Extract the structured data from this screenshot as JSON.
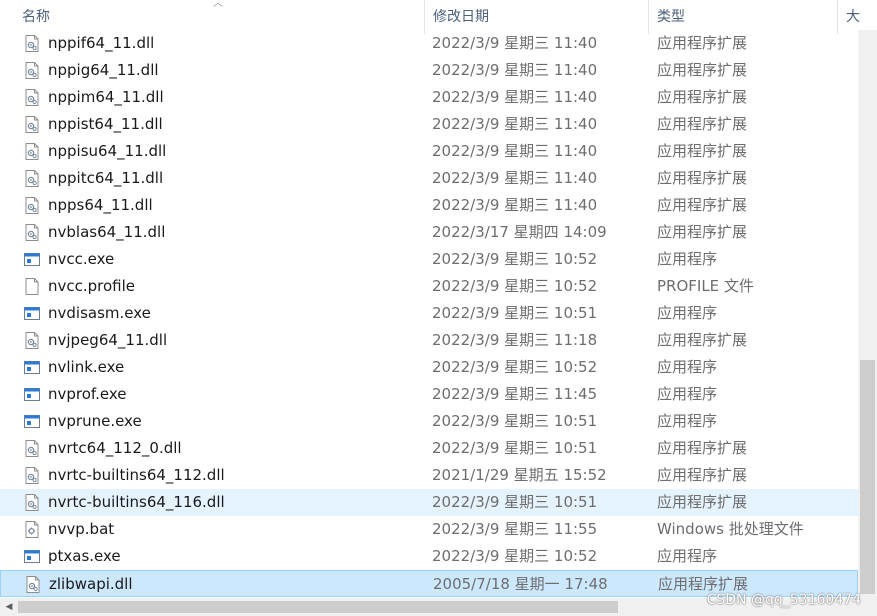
{
  "columns": {
    "name": "名称",
    "date": "修改日期",
    "type": "类型",
    "size": "大"
  },
  "files": [
    {
      "name": "nppif64_11.dll",
      "date": "2022/3/9 星期三 11:40",
      "type": "应用程序扩展",
      "icon": "dll-icon"
    },
    {
      "name": "nppig64_11.dll",
      "date": "2022/3/9 星期三 11:40",
      "type": "应用程序扩展",
      "icon": "dll-icon"
    },
    {
      "name": "nppim64_11.dll",
      "date": "2022/3/9 星期三 11:40",
      "type": "应用程序扩展",
      "icon": "dll-icon"
    },
    {
      "name": "nppist64_11.dll",
      "date": "2022/3/9 星期三 11:40",
      "type": "应用程序扩展",
      "icon": "dll-icon"
    },
    {
      "name": "nppisu64_11.dll",
      "date": "2022/3/9 星期三 11:40",
      "type": "应用程序扩展",
      "icon": "dll-icon"
    },
    {
      "name": "nppitc64_11.dll",
      "date": "2022/3/9 星期三 11:40",
      "type": "应用程序扩展",
      "icon": "dll-icon"
    },
    {
      "name": "npps64_11.dll",
      "date": "2022/3/9 星期三 11:40",
      "type": "应用程序扩展",
      "icon": "dll-icon"
    },
    {
      "name": "nvblas64_11.dll",
      "date": "2022/3/17 星期四 14:09",
      "type": "应用程序扩展",
      "icon": "dll-icon"
    },
    {
      "name": "nvcc.exe",
      "date": "2022/3/9 星期三 10:52",
      "type": "应用程序",
      "icon": "exe-icon"
    },
    {
      "name": "nvcc.profile",
      "date": "2022/3/9 星期三 10:52",
      "type": "PROFILE 文件",
      "icon": "file-icon"
    },
    {
      "name": "nvdisasm.exe",
      "date": "2022/3/9 星期三 10:51",
      "type": "应用程序",
      "icon": "exe-icon"
    },
    {
      "name": "nvjpeg64_11.dll",
      "date": "2022/3/9 星期三 11:18",
      "type": "应用程序扩展",
      "icon": "dll-icon"
    },
    {
      "name": "nvlink.exe",
      "date": "2022/3/9 星期三 10:52",
      "type": "应用程序",
      "icon": "exe-icon"
    },
    {
      "name": "nvprof.exe",
      "date": "2022/3/9 星期三 11:45",
      "type": "应用程序",
      "icon": "exe-icon"
    },
    {
      "name": "nvprune.exe",
      "date": "2022/3/9 星期三 10:51",
      "type": "应用程序",
      "icon": "exe-icon"
    },
    {
      "name": "nvrtc64_112_0.dll",
      "date": "2022/3/9 星期三 10:51",
      "type": "应用程序扩展",
      "icon": "dll-icon"
    },
    {
      "name": "nvrtc-builtins64_112.dll",
      "date": "2021/1/29 星期五 15:52",
      "type": "应用程序扩展",
      "icon": "dll-icon"
    },
    {
      "name": "nvrtc-builtins64_116.dll",
      "date": "2022/3/9 星期三 10:51",
      "type": "应用程序扩展",
      "icon": "dll-icon",
      "state": "hover"
    },
    {
      "name": "nvvp.bat",
      "date": "2022/3/9 星期三 11:55",
      "type": "Windows 批处理文件",
      "icon": "bat-icon"
    },
    {
      "name": "ptxas.exe",
      "date": "2022/3/9 星期三 10:52",
      "type": "应用程序",
      "icon": "exe-icon"
    },
    {
      "name": "zlibwapi.dll",
      "date": "2005/7/18 星期一 17:48",
      "type": "应用程序扩展",
      "icon": "dll-icon",
      "state": "selected"
    }
  ],
  "watermark": "CSDN @qq_53160474"
}
